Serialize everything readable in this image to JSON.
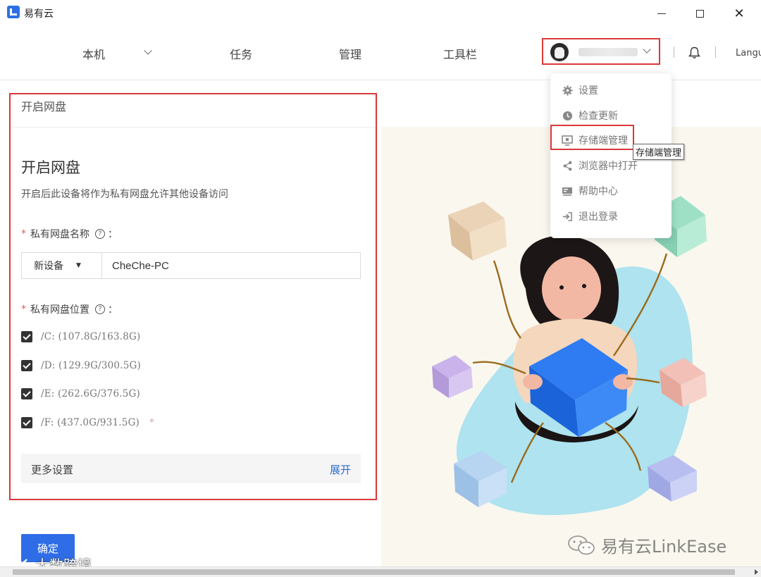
{
  "window": {
    "title": "易有云",
    "icons": [
      "minimize-icon",
      "maximize-icon",
      "close-icon"
    ]
  },
  "nav": {
    "items": [
      {
        "label": "本机",
        "has_dropdown": true
      },
      {
        "label": "任务"
      },
      {
        "label": "管理"
      },
      {
        "label": "工具栏"
      }
    ],
    "language": "Langu"
  },
  "user_menu": {
    "items": [
      {
        "label": "设置",
        "icon": "gear-icon"
      },
      {
        "label": "检查更新",
        "icon": "clock-icon"
      },
      {
        "label": "存储端管理",
        "icon": "monitor-icon"
      },
      {
        "label": "浏览器中打开",
        "icon": "share-icon"
      },
      {
        "label": "帮助中心",
        "icon": "help-book-icon"
      },
      {
        "label": "退出登录",
        "icon": "logout-icon"
      }
    ],
    "tooltip": "存储端管理"
  },
  "panel": {
    "title": "开启网盘",
    "heading": "开启网盘",
    "description": "开启后此设备将作为私有网盘允许其他设备访问",
    "name_field": {
      "required_mark": "*",
      "label": "私有网盘名称",
      "help": "?",
      "colon": "：",
      "device_option": "新设备",
      "value": "CheChe-PC"
    },
    "location_field": {
      "required_mark": "*",
      "label": "私有网盘位置",
      "help": "?",
      "colon": "：",
      "drives": [
        {
          "text": "/C: (107.8G/163.8G)",
          "checked": true
        },
        {
          "text": "/D: (129.9G/300.5G)",
          "checked": true
        },
        {
          "text": "/E: (262.6G/376.5G)",
          "checked": true
        },
        {
          "text": "/F: (437.0G/931.5G)",
          "checked": true,
          "star": "*"
        }
      ]
    },
    "more_settings": {
      "label": "更多设置",
      "expand": "展开"
    },
    "confirm": "确定"
  },
  "watermarks": {
    "right": "易有云LinkEase",
    "left": "大数跨境"
  },
  "colors": {
    "accent": "#2f6de6",
    "highlight_border": "#d9383a",
    "illustration_bg": "#faf7ef"
  }
}
